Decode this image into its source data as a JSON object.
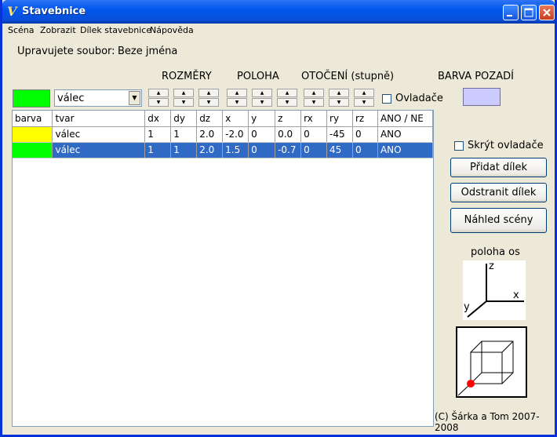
{
  "window": {
    "title": "Stavebnice",
    "icon": "app-logo-icon",
    "controls": [
      "minimize-icon",
      "maximize-icon",
      "close-icon"
    ]
  },
  "menu": [
    "Scéna",
    "Zobrazit",
    "Dílek stavebnice",
    "Nápověda"
  ],
  "file": {
    "label": "Upravujete soubor:",
    "name": "Beze jména"
  },
  "sections": {
    "rozmery": "ROZMĚRY",
    "poloha": "POLOHA",
    "otoceni": "OTOČENÍ (stupně)",
    "barva_pozadi": "BARVA POZADÍ"
  },
  "editor": {
    "current_color": "#00FF00",
    "shape_value": "válec",
    "ovladace_label": "Ovladače",
    "ovladace_checked": false,
    "background_color": "#CBCBFF"
  },
  "table": {
    "headers": [
      "barva",
      "tvar",
      "dx",
      "dy",
      "dz",
      "x",
      "y",
      "z",
      "rx",
      "ry",
      "rz",
      "ANO / NE"
    ],
    "rows": [
      {
        "color": "#FFFF00",
        "cells": [
          "válec",
          "1",
          "1",
          "2.0",
          "-2.0",
          "0",
          "0.0",
          "0",
          "-45",
          "0",
          "ANO"
        ],
        "selected": false
      },
      {
        "color": "#00FF00",
        "cells": [
          "válec",
          "1",
          "1",
          "2.0",
          "1.5",
          "0",
          "-0.7",
          "0",
          "45",
          "0",
          "ANO"
        ],
        "selected": true
      }
    ]
  },
  "side": {
    "hide_controls_label": "Skrýt ovladače",
    "hide_controls_checked": false,
    "add_button": "Přidat dílek",
    "remove_button": "Odstranit dílek",
    "preview_button": "Náhled scény",
    "axes_title": "poloha os",
    "axes": {
      "z": "z",
      "x": "x",
      "y": "y"
    },
    "copyright": "(C) Šárka a Tom 2007-2008"
  },
  "colors": {
    "selection": "#316AC5",
    "accent_red": "#FF0000"
  }
}
